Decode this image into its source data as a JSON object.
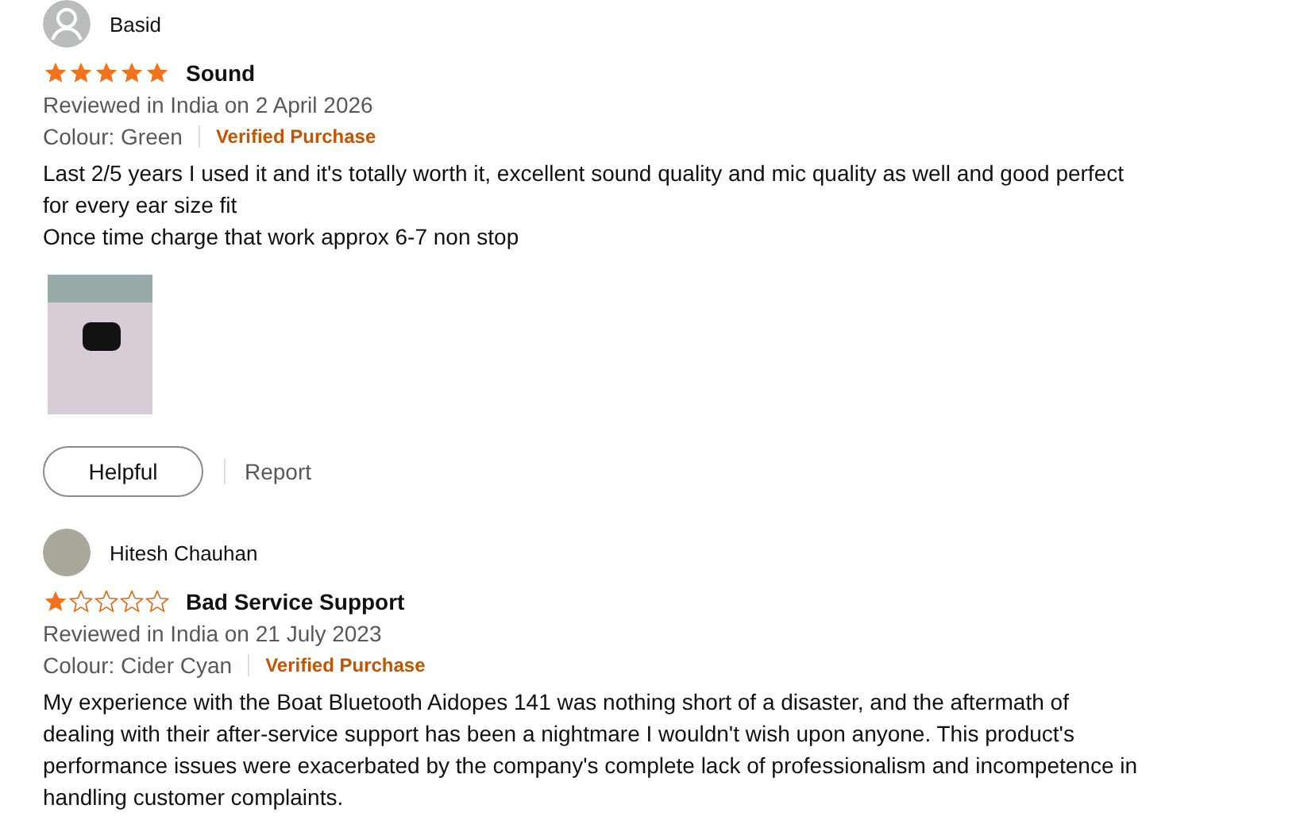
{
  "reviews": [
    {
      "author": "Basid",
      "avatar": {
        "kind": "silhouette"
      },
      "stars": 5,
      "title": "Sound",
      "reviewed": "Reviewed in India on 2 April 2026",
      "colour": "Colour: Green",
      "badge": "Verified Purchase",
      "body": [
        "Last 2/5 years I used it and it's totally worth it, excellent sound quality and mic quality as well and good perfect for every ear size fit",
        "Once time charge that work approx 6-7 non stop"
      ],
      "photos": [
        {
          "kind": "photo"
        }
      ],
      "actions": {
        "helpful": "Helpful",
        "report": "Report"
      }
    },
    {
      "author": "Hitesh Chauhan",
      "avatar": {
        "kind": "photo"
      },
      "stars": 1,
      "title": "Bad Service Support",
      "reviewed": "Reviewed in India on 21 July 2023",
      "colour": "Colour: Cider Cyan",
      "badge": "Verified Purchase",
      "body": [
        "My experience with the Boat Bluetooth Aidopes 141 was nothing short of a disaster, and the aftermath of dealing with their after-service support has been a nightmare I wouldn't wish upon anyone. This product's performance issues were exacerbated by the company's complete lack of professionalism and incompetence in handling customer complaints."
      ]
    }
  ]
}
